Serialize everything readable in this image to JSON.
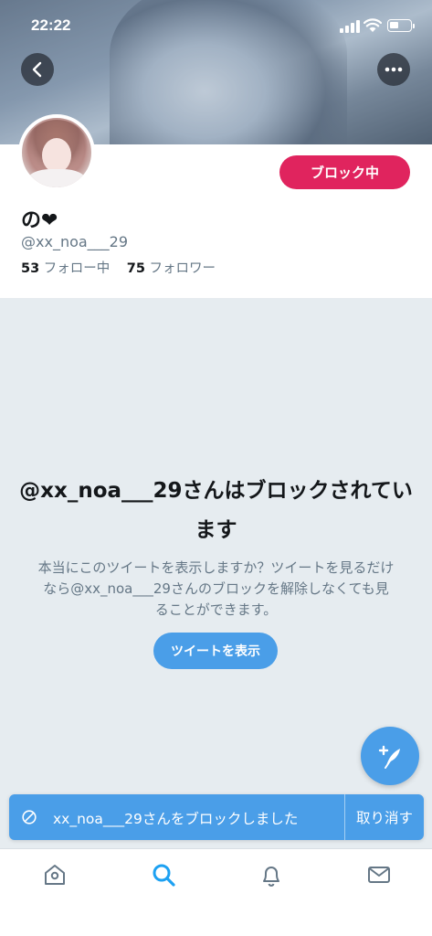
{
  "status_bar": {
    "time": "22:22"
  },
  "profile": {
    "display_name": "の❤",
    "handle": "@xx_noa___29",
    "following_count": "53",
    "following_label": "フォロー中",
    "followers_count": "75",
    "followers_label": "フォロワー",
    "block_button_label": "ブロック中"
  },
  "blocked_notice": {
    "title": "@xx_noa___29さんはブロックされています",
    "description": "本当にこのツイートを表示しますか？ツイートを見るだけなら@xx_noa___29さんのブロックを解除しなくても見ることができます。",
    "show_button_label": "ツイートを表示"
  },
  "toast": {
    "message": "xx_noa___29さんをブロックしました",
    "undo_label": "取り消す"
  },
  "tab_bar": {
    "items": [
      {
        "name": "home",
        "icon": "home-icon"
      },
      {
        "name": "search",
        "icon": "search-icon",
        "active": true
      },
      {
        "name": "notifications",
        "icon": "bell-icon"
      },
      {
        "name": "messages",
        "icon": "envelope-icon"
      }
    ]
  },
  "colors": {
    "accent": "#4a9ee8",
    "blocked_red": "#e0245e",
    "active_tab": "#1da1f2",
    "inactive_tab": "#657786"
  }
}
